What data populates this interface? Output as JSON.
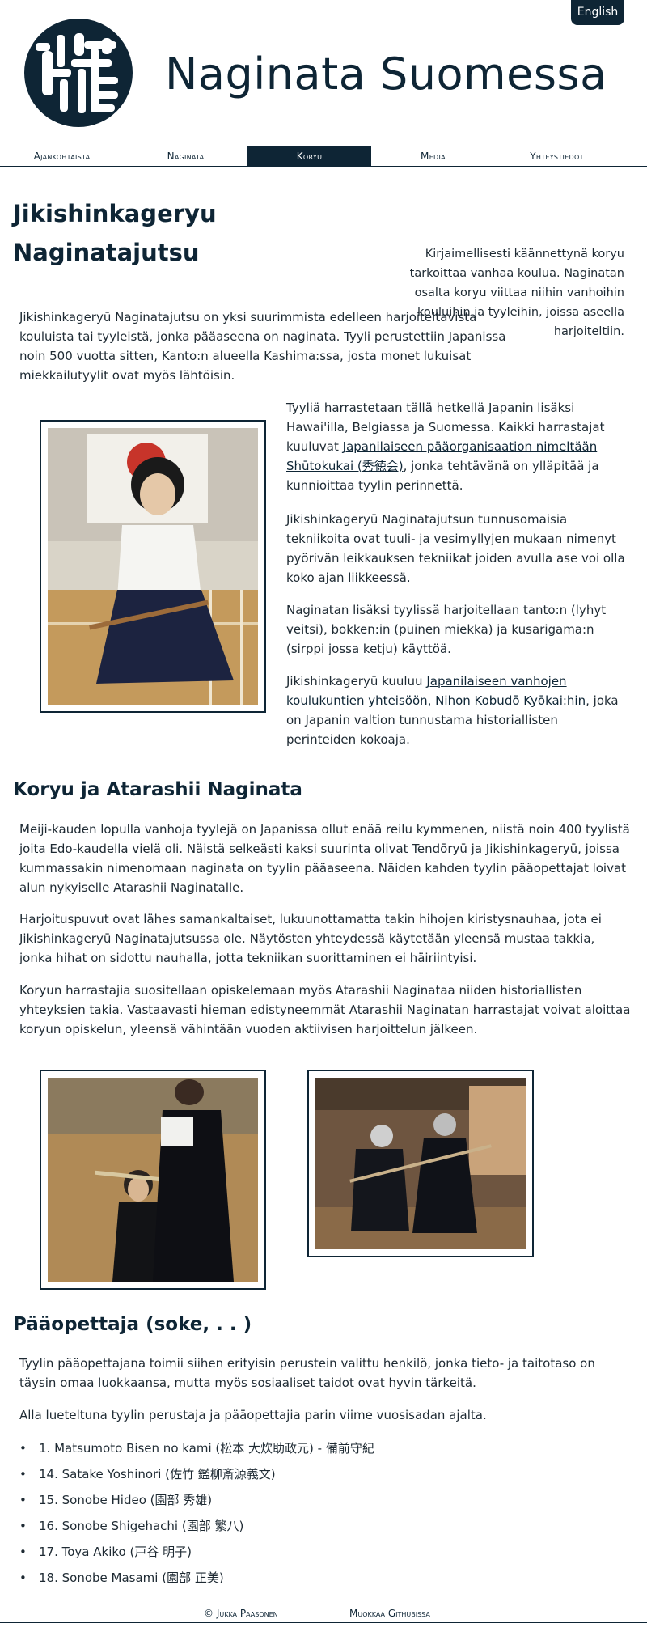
{
  "language_button": "English",
  "site": {
    "title": "Naginata Suomessa"
  },
  "nav": [
    {
      "label": "Ajankohtaista"
    },
    {
      "label": "Naginata"
    },
    {
      "label": "Koryu"
    },
    {
      "label": "Media"
    },
    {
      "label": "Yhteystiedot"
    }
  ],
  "main": {
    "title_line1": "Jikishinkageryu",
    "title_line2": "Naginatajutsu",
    "pull_quote": "Kirjaimellisesti käännettynä koryu tarkoittaa vanhaa koulua. Naginatan osalta koryu viittaa niihin vanhoihin kouluihin ja tyyleihin, joissa aseella harjoiteltiin.",
    "intro": "Jikishinkageryū Naginatajutsu on yksi suurimmista edelleen harjoiteltavista kouluista tai tyyleistä, jonka pääaseena on naginata. Tyyli perustettiin Japanissa noin 500 vuotta sitten, Kanto:n alueella Kashima:ssa, josta monet lukuisat miekkailutyylit ovat myös lähtöisin.",
    "p2_before": "Tyyliä harrastetaan tällä hetkellä Japanin lisäksi Hawai'illa, Belgiassa ja Suomessa. Kaikki harrastajat kuuluvat ",
    "p2_link": "Japanilaiseen pääorganisaation nimeltään Shūtokukai (秀徳会)",
    "p2_after": ", jonka tehtävänä on ylläpitää ja kunnioittaa tyylin perinnettä.",
    "p3": "Jikishinkageryū Naginatajutsun tunnusomaisia tekniikoita ovat tuuli- ja vesimyllyjen mukaan nimenyt pyörivän leikkauksen tekniikat joiden avulla ase voi olla koko ajan liikkeessä.",
    "p4": "Naginatan lisäksi tyylissä harjoitellaan tanto:n (lyhyt veitsi), bokken:in (puinen miekka) ja kusarigama:n (sirppi jossa ketju) käyttöä.",
    "p5_before": "Jikishinkageryū kuuluu ",
    "p5_link": "Japanilaiseen vanhojen koulukuntien yhteisöön, Nihon Kobudō Kyōkai:hin",
    "p5_after": ", joka on Japanin valtion tunnustama historiallisten perinteiden kokoaja."
  },
  "section2": {
    "title": "Koryu ja Atarashii Naginata",
    "p1": "Meiji-kauden lopulla vanhoja tyylejä on Japanissa ollut enää reilu kymmenen, niistä noin 400 tyylistä joita Edo-kaudella vielä oli. Näistä selkeästi kaksi suurinta olivat Tendōryū ja Jikishinkageryū, joissa kummassakin nimenomaan naginata on tyylin pääaseena. Näiden kahden tyylin pääopettajat loivat alun nykyiselle Atarashii Naginatalle.",
    "p2": "Harjoituspuvut ovat lähes samankaltaiset, lukuunottamatta takin hihojen kiristysnauhaa, jota ei Jikishinkageryū Naginatajutsussa ole. Näytösten yhteydessä käytetään yleensä mustaa takkia, jonka hihat on sidottu nauhalla, jotta tekniikan suorittaminen ei häiriintyisi.",
    "p3": "Koryun harrastajia suositellaan opiskelemaan myös Atarashii Naginataa niiden historiallisten yhteyksien takia. Vastaavasti hieman edistyneemmät Atarashii Naginatan harrastajat voivat aloittaa koryun opiskelun, yleensä vähintään vuoden aktiivisen harjoittelun jälkeen."
  },
  "section3": {
    "title": "Pääopettaja (soke, .   .   )",
    "p1": "Tyylin pääopettajana toimii siihen erityisin perustein valittu henkilö, jonka tieto- ja taitotaso on täysin omaa luokkaansa, mutta myös sosiaaliset taidot ovat hyvin tärkeitä.",
    "p2": "Alla lueteltuna tyylin perustaja ja pääopettajia parin viime vuosisadan ajalta.",
    "list": [
      "1. Matsumoto Bisen no kami (松本 大炊助政元) - 備前守紀",
      "14. Satake Yoshinori (佐竹 鑑柳斎源義文)",
      "15. Sonobe Hideo (園部 秀雄)",
      "16. Sonobe Shigehachi (園部 繁八)",
      "17. Toya Akiko (戸谷 明子)",
      "18. Sonobe Masami (園部 正美)"
    ]
  },
  "footer": {
    "copyright": "© Jukka Paasonen",
    "edit_link": "Muokkaa Githubissa"
  },
  "colors": {
    "primary": "#0e2535",
    "text": "#1e2a33"
  }
}
